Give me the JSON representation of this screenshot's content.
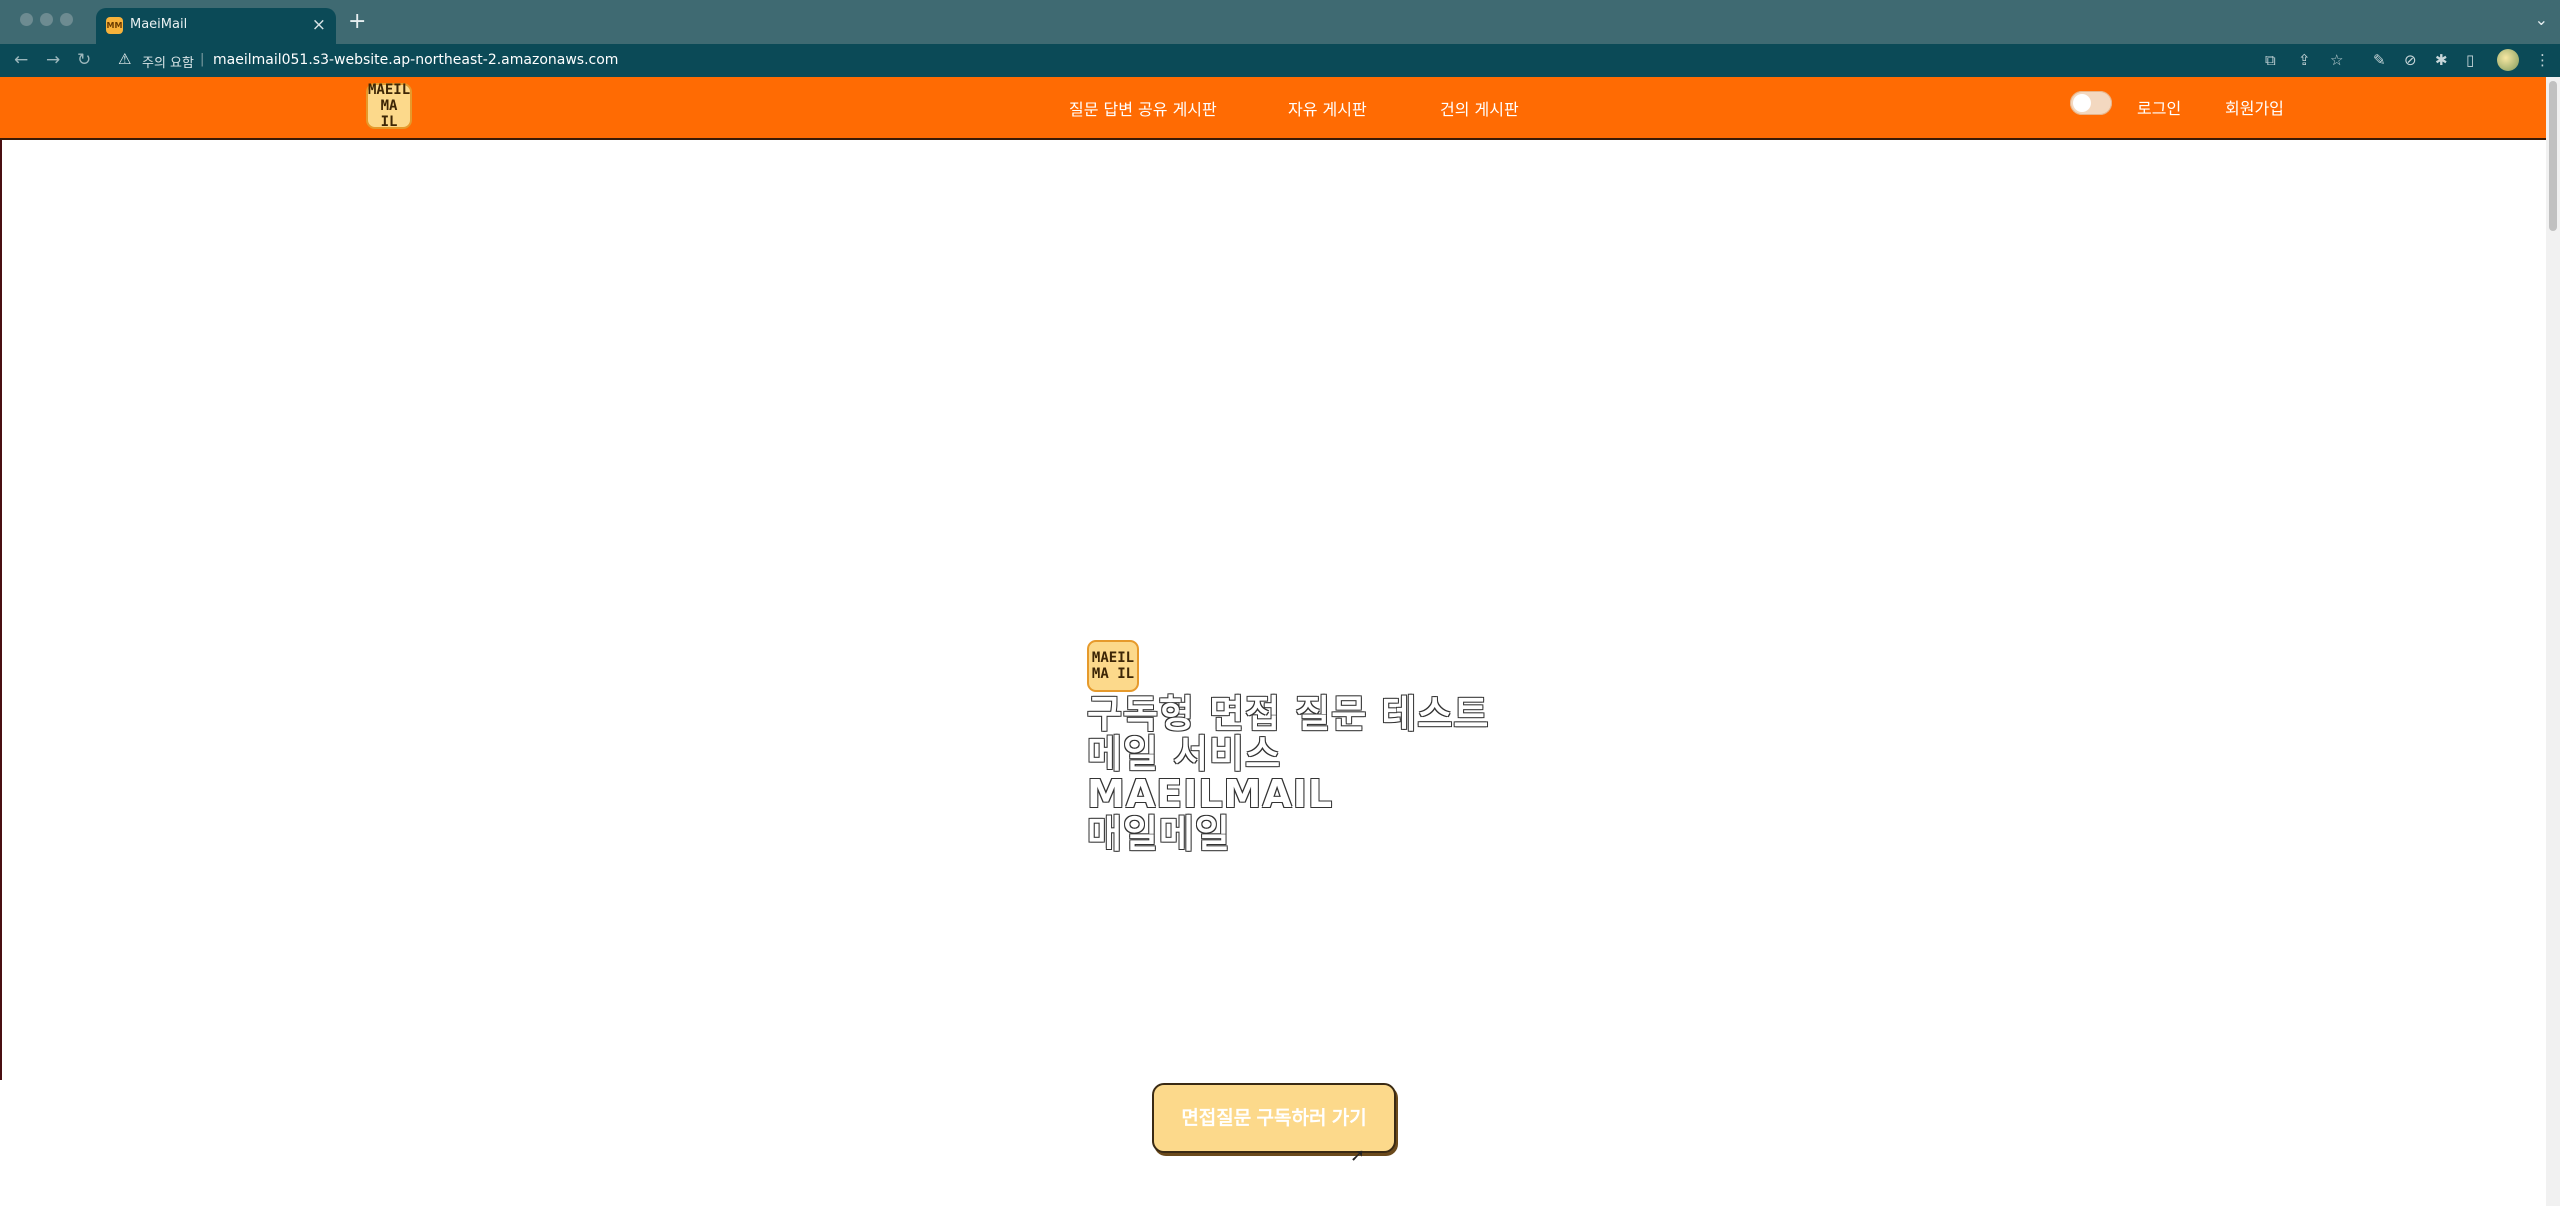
{
  "browser": {
    "tab_title": "MaeiMail",
    "tab_favicon_text": "MM",
    "security_warning": "주의 요함",
    "url": "maeilmail051.s3-website.ap-northeast-2.amazonaws.com"
  },
  "header": {
    "logo_line1": "MAEIL",
    "logo_line2": "MA IL",
    "nav": [
      {
        "label": "질문 답변 공유 게시판"
      },
      {
        "label": "자유 게시판"
      },
      {
        "label": "건의 게시판"
      }
    ],
    "login_label": "로그인",
    "signup_label": "회원가입",
    "theme_toggle_on": false
  },
  "hero": {
    "logo_line1": "MAEIL",
    "logo_line2": "MA IL",
    "lines": [
      "구독형 면접 질문 테스트",
      "메일 서비스",
      "MAEILMAIL",
      "매일메일"
    ],
    "cta_label": "면접질문 구독하러 가기"
  },
  "colors": {
    "header_bg": "#ff6b03",
    "logo_bg": "#fcd98b",
    "chrome_tab": "#0b4a57"
  }
}
